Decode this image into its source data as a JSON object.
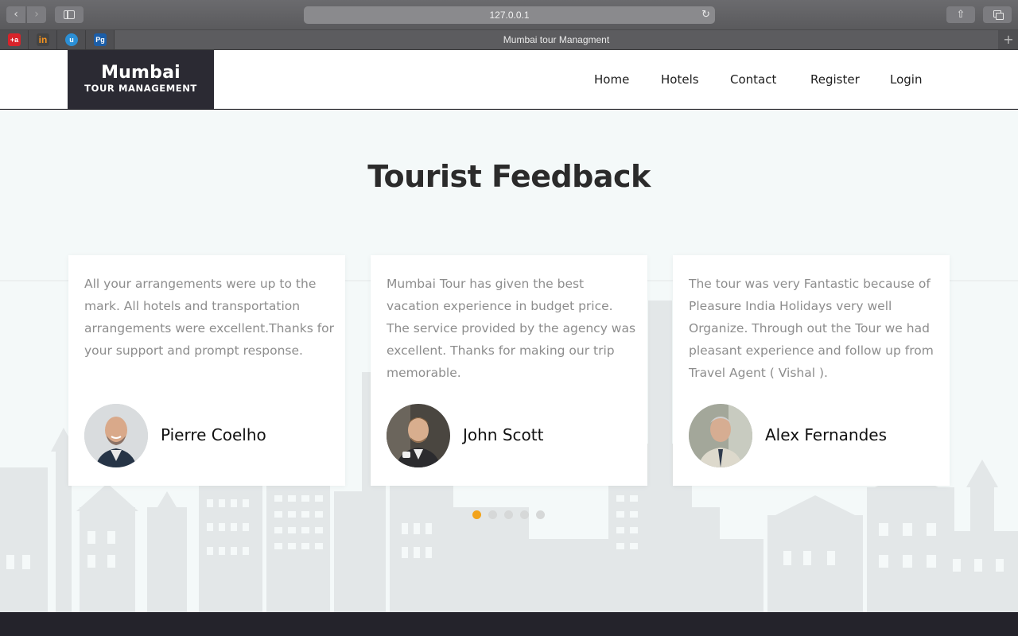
{
  "browser": {
    "url": "127.0.0.1",
    "tab_title": "Mumbai tour Managment",
    "back_glyph": "‹",
    "forward_glyph": "›",
    "reload_glyph": "↻",
    "share_glyph": "⇧",
    "new_tab_glyph": "+",
    "favicons": [
      {
        "name": "favicon-red",
        "glyph": "+a"
      },
      {
        "name": "favicon-invision",
        "glyph": "in"
      },
      {
        "name": "favicon-blue-circle",
        "glyph": "u"
      },
      {
        "name": "favicon-pg",
        "glyph": "Pg"
      }
    ]
  },
  "site": {
    "logo_title": "Mumbai",
    "logo_subtitle": "TOUR MANAGEMENT",
    "nav": [
      "Home",
      "Hotels",
      "Contact",
      "Register",
      "Login"
    ]
  },
  "section": {
    "title": "Tourist Feedback"
  },
  "testimonials": [
    {
      "text": "All your arrangements were up to the mark. All hotels and transportation arrangements were excellent.Thanks for your support and prompt response.",
      "author": "Pierre Coelho"
    },
    {
      "text": "Mumbai Tour has given the best vacation experience in budget price. The service provided by the agency was excellent. Thanks for making our trip memorable.",
      "author": "John Scott"
    },
    {
      "text": "The tour was very Fantastic because of Pleasure India Holidays very well Organize. Through out the Tour we had pleasant experience and follow up from Travel Agent ( Vishal ).",
      "author": "Alex Fernandes"
    }
  ],
  "carousel": {
    "page_count": 5,
    "active_page": 1
  },
  "colors": {
    "accent": "#f2a31b",
    "logo_bg": "#2b2a33",
    "section_bg": "#f4f9f9",
    "footer_bg": "#24232b"
  }
}
